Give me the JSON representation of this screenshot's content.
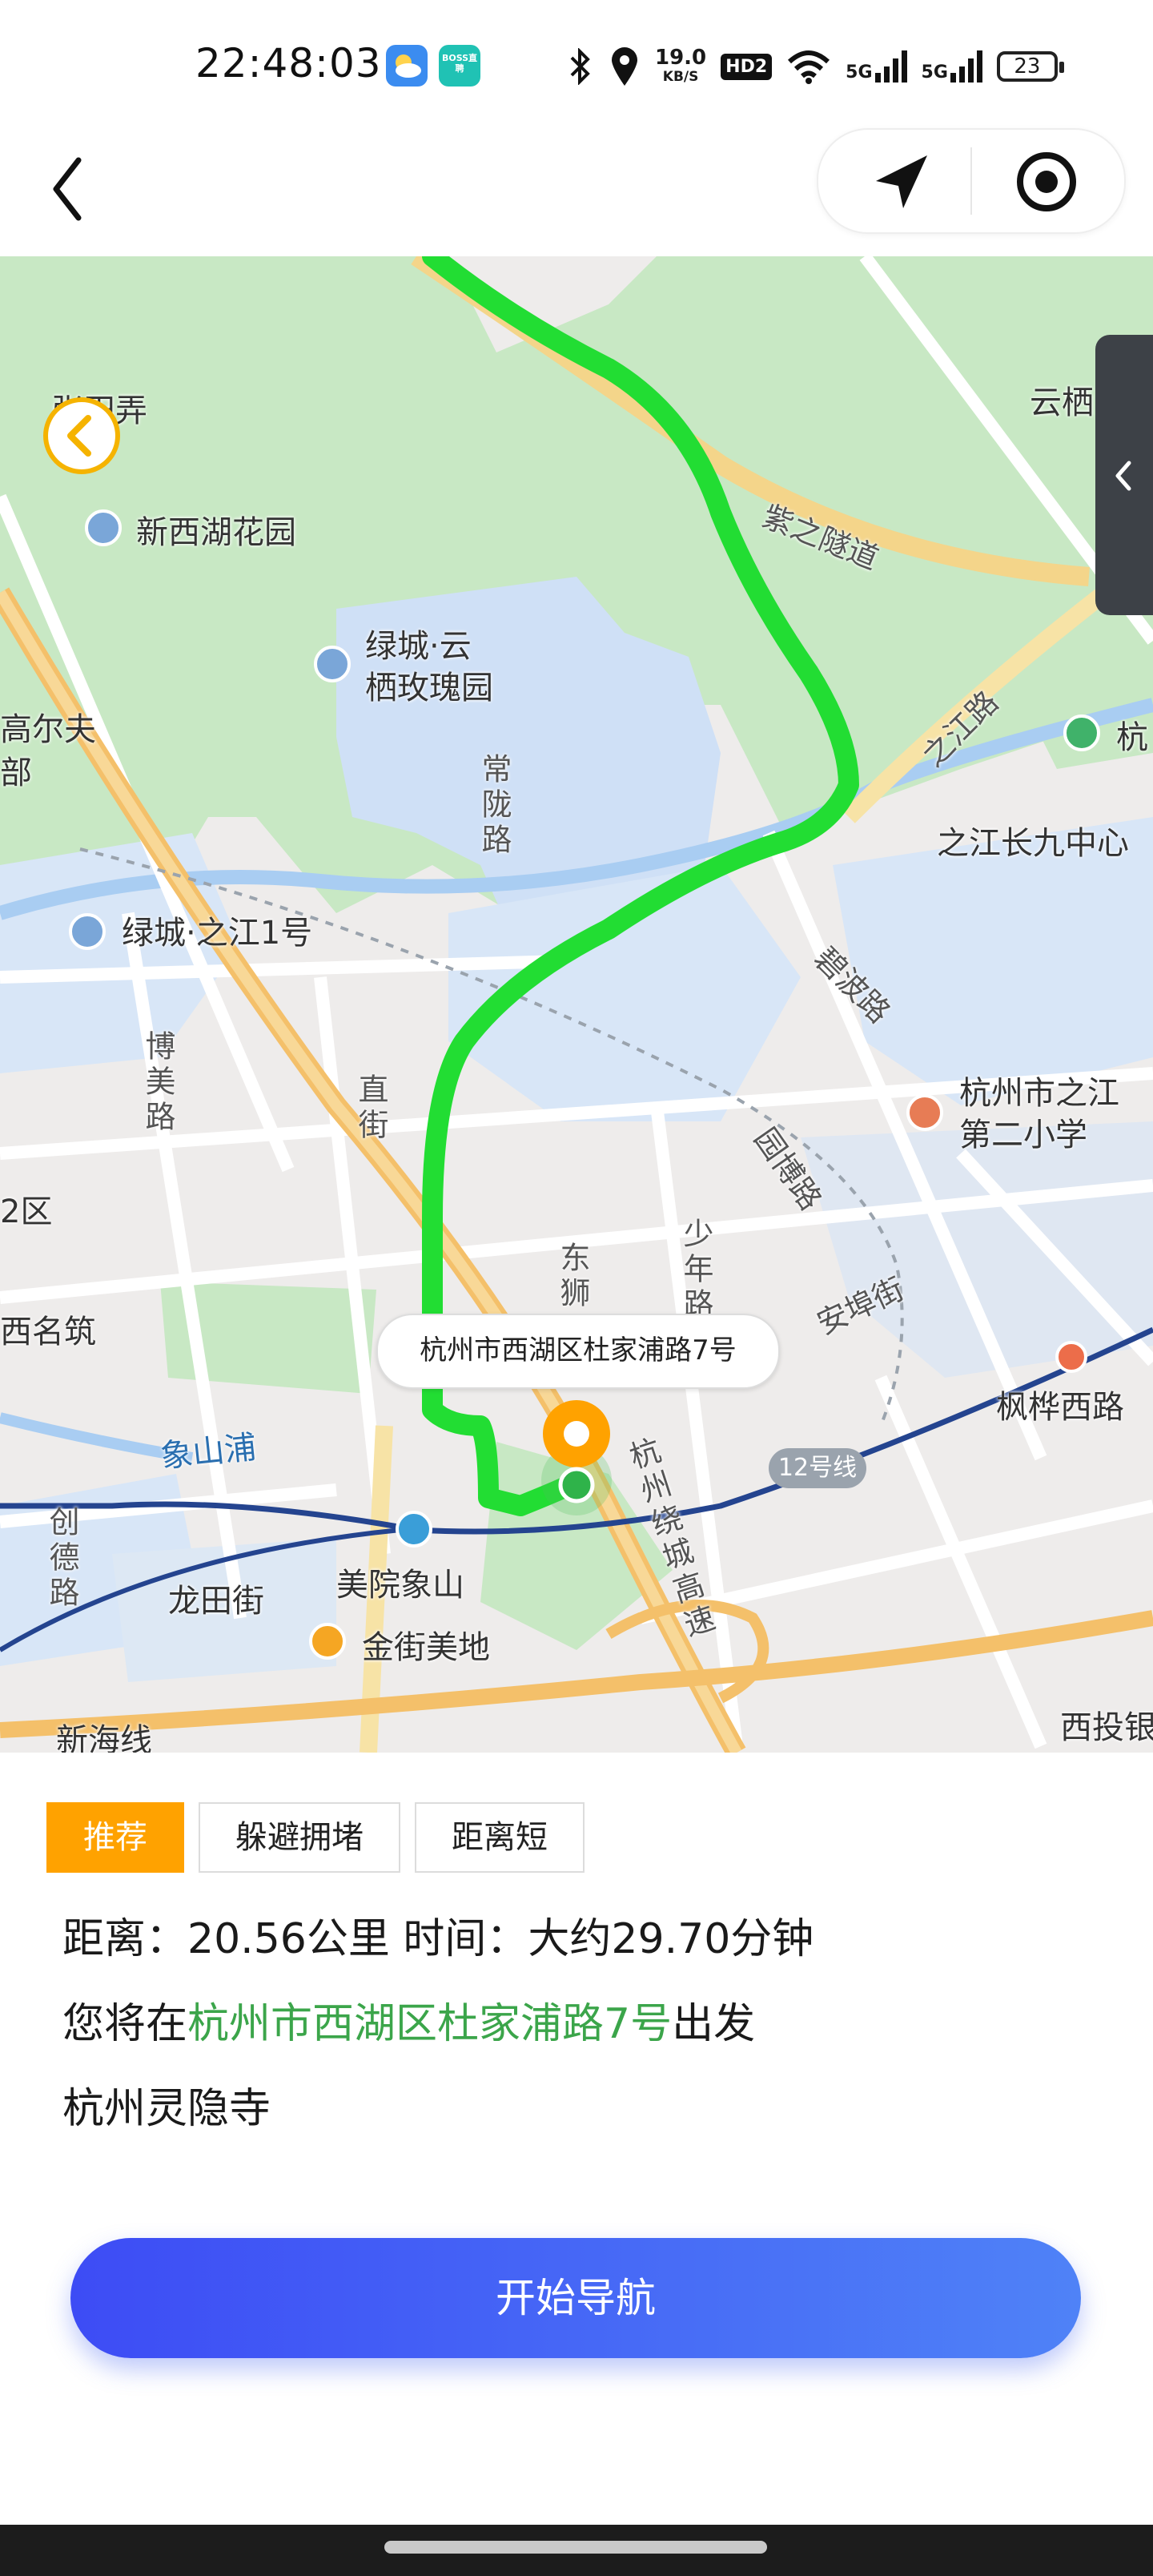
{
  "status_bar": {
    "time": "22:48:03",
    "app_icons": [
      "weather-icon",
      "boss-zhipin-icon"
    ],
    "boss_label": "BOSS直聘",
    "net_speed_value": "19.0",
    "net_speed_unit": "KB/S",
    "hd_badge": "HD2",
    "signal1": "5G",
    "signal2": "5G",
    "battery": "23",
    "icons": [
      "bluetooth-icon",
      "location-pin-icon",
      "wifi-icon",
      "signal-icon",
      "battery-icon"
    ]
  },
  "header": {
    "back_icon": "chevron-left-icon",
    "locate_icon": "navigation-arrow-icon",
    "target_icon": "target-icon"
  },
  "map": {
    "labels": [
      {
        "text": "张田弄"
      },
      {
        "text": "新西湖花园"
      },
      {
        "text": "绿城·云"
      },
      {
        "text": "栖玫瑰园"
      },
      {
        "text": "紫之隧道"
      },
      {
        "text": "云栖"
      },
      {
        "text": "高尔夫"
      },
      {
        "text": "部"
      },
      {
        "text": "常陇路"
      },
      {
        "text": "之江路"
      },
      {
        "text": "之江长九中心"
      },
      {
        "text": "杭"
      },
      {
        "text": "绿城·之江1号"
      },
      {
        "text": "碧波路"
      },
      {
        "text": "博美路"
      },
      {
        "text": "直街"
      },
      {
        "text": "杭州市之江"
      },
      {
        "text": "第二小学"
      },
      {
        "text": "园博路"
      },
      {
        "text": "2区"
      },
      {
        "text": "少年路"
      },
      {
        "text": "东狮"
      },
      {
        "text": "安埠街"
      },
      {
        "text": "西名筑"
      },
      {
        "text": "枫桦西路"
      },
      {
        "text": "象山浦"
      },
      {
        "text": "杭州绕城高速"
      },
      {
        "text": "创德路"
      },
      {
        "text": "美院象山"
      },
      {
        "text": "龙田街"
      },
      {
        "text": "金街美地"
      },
      {
        "text": "新海线"
      },
      {
        "text": "西投银"
      }
    ],
    "start_bubble": "杭州市西湖区杜家浦路7号",
    "metro_line": "12号线",
    "map_back_icon": "chevron-left-icon",
    "side_handle_icon": "chevron-left-icon",
    "route_color": "#22dd33"
  },
  "route_options": {
    "tabs": [
      "推荐",
      "躲避拥堵",
      "距离短"
    ],
    "active_index": 0
  },
  "trip": {
    "distance_label": "距离：",
    "distance_value": "20.56公里",
    "time_label": " 时间：",
    "time_value": "大约29.70分钟",
    "depart_prefix": "您将在",
    "depart_place": "杭州市西湖区杜家浦路7号",
    "depart_suffix": "出发",
    "destination": "杭州灵隐寺"
  },
  "actions": {
    "start_navigation": "开始导航"
  },
  "colors": {
    "accent_orange": "#ffa200",
    "button_blue": "#4a66f6",
    "highlight_green": "#3ba54a"
  }
}
